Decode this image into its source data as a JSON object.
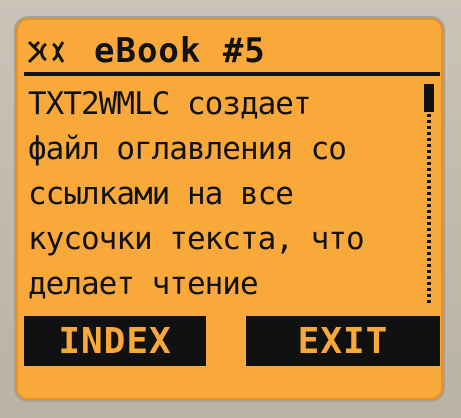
{
  "header": {
    "title": "eBook #5",
    "icon": "wml-logo-icon"
  },
  "content": {
    "lines": [
      "TXT2WMLC создает",
      "файл оглавления со",
      "ссылками на все",
      "кусочки текста, что",
      "делает чтение"
    ]
  },
  "scrollbar": {
    "position_fraction": 0.0
  },
  "softkeys": {
    "left_label": "INDEX",
    "right_label": "EXIT"
  },
  "colors": {
    "screen_background": "#f9a93a",
    "text": "#111111"
  }
}
